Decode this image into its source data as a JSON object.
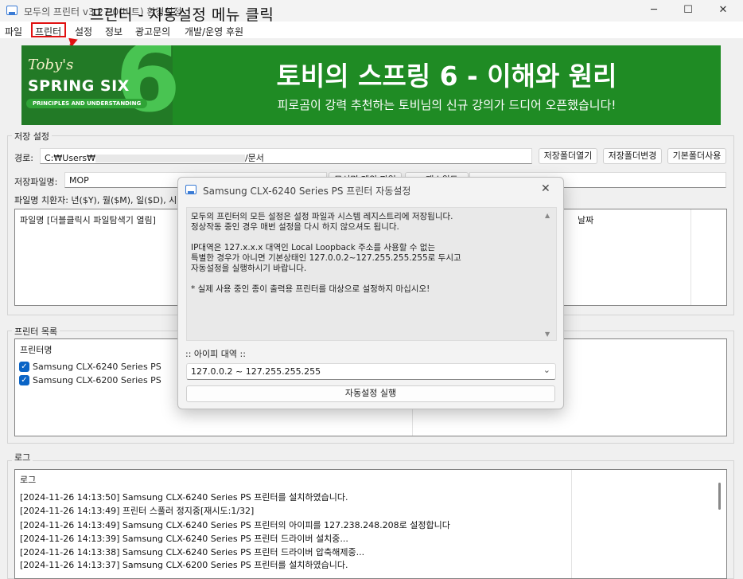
{
  "window": {
    "title": "모두의 프린터 v3.27.0(비트) 환경설정",
    "minimize_icon": "─",
    "maximize_icon": "☐",
    "close_icon": "✕"
  },
  "overlay_caption": "프린터 - 자동설정 메뉴 클릭",
  "menu": {
    "items": [
      {
        "label": "파일"
      },
      {
        "label": "프린터"
      },
      {
        "label": "설정"
      },
      {
        "label": "정보"
      },
      {
        "label": "광고문의"
      },
      {
        "label": "개발/운영 후원"
      }
    ],
    "highlight_color": "#e01010"
  },
  "banner": {
    "tobys": "Toby's",
    "spring_six": "SPRING SIX",
    "principles": "PRINCIPLES AND UNDERSTANDING",
    "six_numeral": "6",
    "title": "토비의 스프링 6 - 이해와 원리",
    "subtitle": "피로곰이 강력 추천하는 토비님의 신규 강의가 드디어 오픈했습니다!",
    "bg_color": "#1f8b24"
  },
  "storage": {
    "group_title": "저장 설정",
    "path_label": "경로:",
    "path_value_prefix": "C:₩Users₩",
    "path_value_suffix": "/문서",
    "open_folder_button": "저장폴더열기",
    "change_folder_button": "저장폴더변경",
    "default_folder_button": "기본폴더사용",
    "filename_label": "저장파일명:",
    "filename_value": "MOP",
    "partial_button_1": "모서명 제외 파일",
    "partial_button_2": "pc패스워드",
    "substitute_label": "파일명 치환자: 년($Y), 월($M), 일($D), 시",
    "list_col_1": "파일명 [더블클릭시 파일탐색기 열림]",
    "list_col_2": "날짜"
  },
  "printers": {
    "group_title": "프린터 목록",
    "col_header": "프린터명",
    "items": [
      {
        "name": "Samsung CLX-6240 Series PS",
        "checked": true
      },
      {
        "name": "Samsung CLX-6200 Series PS",
        "checked": true
      }
    ],
    "check_glyph": "✓"
  },
  "log": {
    "group_title": "로그",
    "col_header": "로그",
    "lines": [
      "[2024-11-26 14:13:50] Samsung CLX-6240 Series PS 프린터를 설치하였습니다.",
      "[2024-11-26 14:13:49] 프린터 스풀러 정지중[재시도:1/32]",
      "[2024-11-26 14:13:49] Samsung CLX-6240 Series PS 프린터의 아이피를 127.238.248.208로 설정합니다",
      "[2024-11-26 14:13:39] Samsung CLX-6240 Series PS 프린터 드라이버 설치중...",
      "[2024-11-26 14:13:38] Samsung CLX-6240 Series PS 프린터 드라이버 압축해제중...",
      "[2024-11-26 14:13:37] Samsung CLX-6200 Series PS 프린터를 설치하였습니다."
    ]
  },
  "dialog": {
    "title": "Samsung CLX-6240 Series PS 프린터 자동설정",
    "close_icon": "✕",
    "message": "모두의 프린터의 모든 설정은 설정 파일과 시스템 레지스트리에 저장됩니다.\n정상작동 중인 경우 매번 설정을 다시 하지 않으셔도 됩니다.\n\nIP대역은 127.x.x.x 대역인 Local Loopback 주소를 사용할 수 없는\n특별한 경우가 아니면 기본상태인 127.0.0.2~127.255.255.255로 두시고\n자동설정을 실행하시기 바랍니다.\n\n* 실제 사용 중인 종이 출력용 프린터를 대상으로 설정하지 마십시오!",
    "scroll_up_icon": "▲",
    "scroll_down_icon": "▼",
    "ip_label": ":: 아이피 대역 ::",
    "ip_select_value": "127.0.0.2 ~ 127.255.255.255",
    "select_chevron": "⌄",
    "run_button": "자동설정 실행"
  }
}
